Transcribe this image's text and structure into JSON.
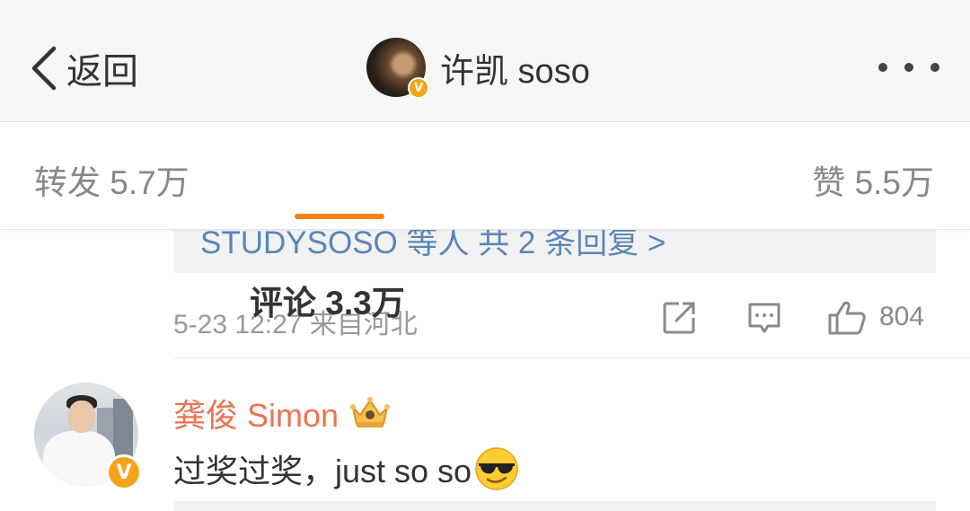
{
  "navbar": {
    "back_label": "返回",
    "user_name": "许凯 soso",
    "verified_badge": "V"
  },
  "tabs": {
    "repost": {
      "label": "转发",
      "count": "5.7万"
    },
    "comment": {
      "label": "评论",
      "count": "3.3万"
    },
    "like": {
      "label": "赞",
      "count": "5.5万"
    },
    "active": "comment"
  },
  "reply_preview": {
    "text": "STUDYSOSO 等人  共 2 条回复 >"
  },
  "prev_comment": {
    "time": "5-23 12:27",
    "source": "来自河北",
    "like_count": "804"
  },
  "comment": {
    "author": "龚俊 Simon",
    "text": "过奖过奖，just so so",
    "verified_badge": "V",
    "emoji": "sunglasses-emoji",
    "badge_icon": "crown-icon"
  },
  "colors": {
    "accent": "#ff8200",
    "link": "#5a86b8",
    "author_name": "#eb7350",
    "badge": "#f7a21b"
  }
}
